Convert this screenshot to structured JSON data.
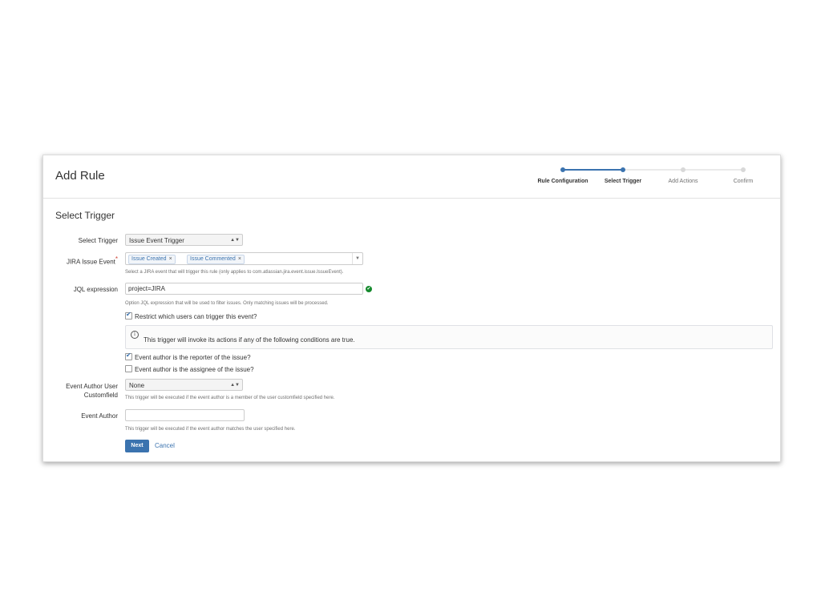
{
  "dialog": {
    "title": "Add Rule"
  },
  "stepper": {
    "steps": [
      {
        "label": "Rule Configuration",
        "state": "done"
      },
      {
        "label": "Select Trigger",
        "state": "active"
      },
      {
        "label": "Add Actions",
        "state": "pending"
      },
      {
        "label": "Confirm",
        "state": "pending"
      }
    ],
    "colors": {
      "done": "#3b73af",
      "pending": "#d8d8d8"
    }
  },
  "section": {
    "title": "Select Trigger"
  },
  "form": {
    "select_trigger": {
      "label": "Select Trigger",
      "value": "Issue Event Trigger"
    },
    "jira_issue_event": {
      "label": "JIRA Issue Event",
      "required_marker": "*",
      "chips": [
        "Issue Created",
        "Issue Commented"
      ],
      "chip_remove": "×",
      "help": "Select a JIRA event that will trigger this rule (only applies to com.atlassian.jira.event.issue.IssueEvent)."
    },
    "jql": {
      "label": "JQL expression",
      "value": "project=JIRA",
      "help": "Option JQL expression that will be used to filter issues. Only matching issues will be processed."
    },
    "restrict_users": {
      "label": "Restrict which users can trigger this event?",
      "checked": true
    },
    "info": {
      "text": "This trigger will invoke its actions if any of the following conditions are true."
    },
    "reporter": {
      "label": "Event author is the reporter of the issue?",
      "checked": true
    },
    "assignee": {
      "label": "Event author is the assignee of the issue?",
      "checked": false
    },
    "author_customfield": {
      "label_line1": "Event Author User",
      "label_line2": "Customfield",
      "value": "None",
      "help": "This trigger will be executed if the event author is a member of the user customfield specified here."
    },
    "event_author": {
      "label": "Event Author",
      "value": "",
      "help": "This trigger will be executed if the event author matches the user specified here."
    }
  },
  "actions": {
    "next_label": "Next",
    "cancel_label": "Cancel"
  },
  "colors": {
    "accent": "#3b73af",
    "success": "#14892c",
    "required": "#d04437"
  }
}
